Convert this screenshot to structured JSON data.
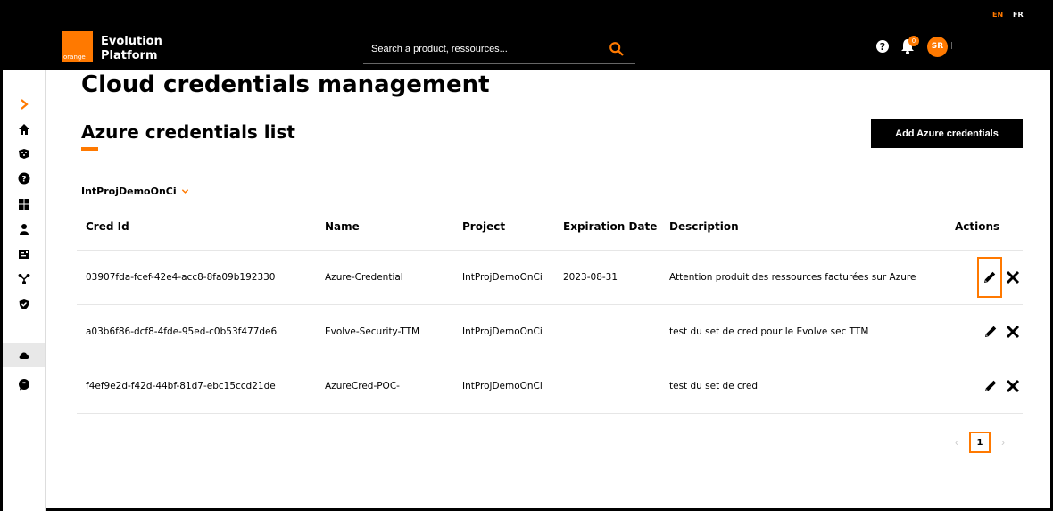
{
  "lang": {
    "en": "EN",
    "fr": "FR"
  },
  "header": {
    "logo_text": "orange",
    "brand_line1": "Evolution",
    "brand_line2": "Platform",
    "search_placeholder": "Search a product, ressources...",
    "notification_count": "0",
    "avatar_initials": "SR"
  },
  "sidebar": {
    "items": [
      "expand-chevron",
      "home-icon",
      "catalog-icon",
      "help-icon",
      "dashboard-icon",
      "user-icon",
      "billing-icon",
      "network-icon",
      "security-icon",
      "cloud-icon",
      "chat-icon"
    ],
    "active": "cloud-icon"
  },
  "main": {
    "page_title": "Cloud credentials management",
    "section_title": "Azure credentials list",
    "add_button": "Add Azure credentials",
    "project_selector": "IntProjDemoOnCi"
  },
  "table": {
    "headers": {
      "cred_id": "Cred Id",
      "name": "Name",
      "project": "Project",
      "expiration": "Expiration Date",
      "description": "Description",
      "actions": "Actions"
    },
    "rows": [
      {
        "cred_id": "03907fda-fcef-42e4-acc8-8fa09b192330",
        "name": "Azure-Credential",
        "project": "IntProjDemoOnCi",
        "expiration": "2023-08-31",
        "description": "Attention produit des ressources facturées sur Azure"
      },
      {
        "cred_id": "a03b6f86-dcf8-4fde-95ed-c0b53f477de6",
        "name": "Evolve-Security-TTM",
        "project": "IntProjDemoOnCi",
        "expiration": "",
        "description": "test du set de cred pour le Evolve sec TTM"
      },
      {
        "cred_id": "f4ef9e2d-f42d-44bf-81d7-ebc15ccd21de",
        "name": "AzureCred-POC-",
        "project": "IntProjDemoOnCi",
        "expiration": "",
        "description": "test du set de cred"
      }
    ]
  },
  "pagination": {
    "current_page": "1"
  },
  "colors": {
    "accent": "#ff7900",
    "header_bg": "#000000"
  }
}
